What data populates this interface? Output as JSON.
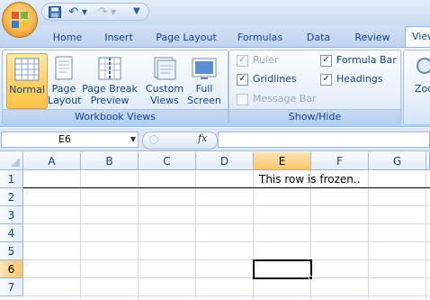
{
  "quick_access": {
    "save_icon": "save-icon",
    "undo_icon": "undo-icon",
    "redo_icon": "redo-icon"
  },
  "tabs": [
    "Home",
    "Insert",
    "Page Layout",
    "Formulas",
    "Data",
    "Review",
    "View"
  ],
  "ribbon": {
    "workbook_views": {
      "label": "Workbook Views",
      "buttons": {
        "normal": "Normal",
        "page_layout_1": "Page",
        "page_layout_2": "Layout",
        "page_break_1": "Page Break",
        "page_break_2": "Preview",
        "custom_views_1": "Custom",
        "custom_views_2": "Views",
        "full_screen_1": "Full",
        "full_screen_2": "Screen"
      }
    },
    "show_hide": {
      "label": "Show/Hide",
      "ruler": "Ruler",
      "gridlines": "Gridlines",
      "message_bar": "Message Bar",
      "formula_bar": "Formula Bar",
      "headings": "Headings",
      "ruler_checked": true,
      "gridlines_checked": true,
      "message_bar_checked": false,
      "formula_bar_checked": true,
      "headings_checked": true
    },
    "zoom_partial": "Zoo"
  },
  "formula_bar": {
    "name_box": "E6",
    "fx": "fx",
    "formula": ""
  },
  "sheet": {
    "columns": [
      "A",
      "B",
      "C",
      "D",
      "E",
      "F",
      "G"
    ],
    "rows": [
      "1",
      "2",
      "3",
      "4",
      "5",
      "6",
      "7"
    ],
    "selected_column": "E",
    "selected_row": "6",
    "cell_e1": "This row is frozen.."
  }
}
